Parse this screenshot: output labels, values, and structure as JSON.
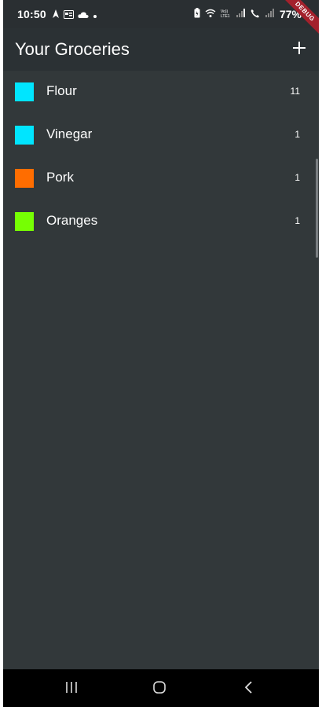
{
  "status_bar": {
    "time": "10:50",
    "battery": "77%",
    "network_label": "Vo))\nLTE1",
    "icons": [
      "navigation-icon",
      "calendar-icon",
      "cloud-icon",
      "dot-icon",
      "battery-saver-icon",
      "wifi-icon",
      "volte-icon",
      "signal-icon",
      "call-icon",
      "signal-2-icon",
      "battery-icon"
    ]
  },
  "app_bar": {
    "title": "Your Groceries",
    "add_icon": "plus-icon",
    "debug_banner": "DEBUG"
  },
  "groceries": [
    {
      "name": "Flour",
      "quantity": "11",
      "color": "#00e5ff"
    },
    {
      "name": "Vinegar",
      "quantity": "1",
      "color": "#00e5ff"
    },
    {
      "name": "Pork",
      "quantity": "1",
      "color": "#ff6d00"
    },
    {
      "name": "Oranges",
      "quantity": "1",
      "color": "#76ff03"
    }
  ],
  "nav_bar": {
    "icons": [
      "recent-apps-icon",
      "home-icon",
      "back-icon"
    ]
  },
  "colors": {
    "background": "#32383a",
    "app_bar": "#2b3134",
    "debug_ribbon": "#a3212c"
  }
}
